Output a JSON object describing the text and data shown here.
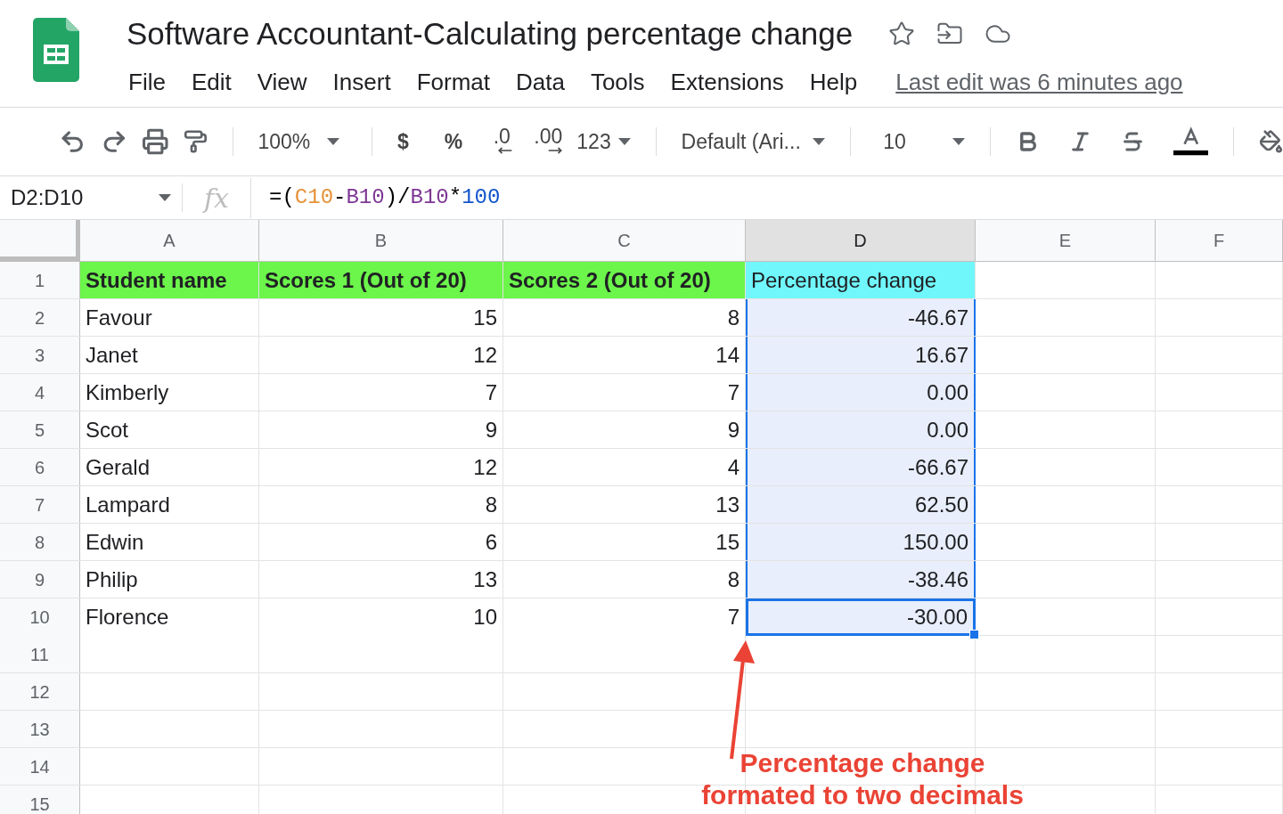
{
  "document": {
    "title": "Software Accountant-Calculating percentage change",
    "last_edit": "Last edit was 6 minutes ago"
  },
  "menu": [
    "File",
    "Edit",
    "View",
    "Insert",
    "Format",
    "Data",
    "Tools",
    "Extensions",
    "Help"
  ],
  "toolbar": {
    "zoom": "100%",
    "currency": "$",
    "percent": "%",
    "decrease_decimals": ".0",
    "increase_decimals": ".00",
    "number_format": "123",
    "font": "Default (Ari...",
    "font_size": "10"
  },
  "formula_bar": {
    "name_box": "D2:D10",
    "function_label": "fx",
    "tokens": [
      {
        "text": "=(",
        "color": "#000000"
      },
      {
        "text": "C10",
        "color": "#e69138"
      },
      {
        "text": "-",
        "color": "#000000"
      },
      {
        "text": "B10",
        "color": "#7e3794"
      },
      {
        "text": ")/",
        "color": "#000000"
      },
      {
        "text": "B10",
        "color": "#7e3794"
      },
      {
        "text": "*",
        "color": "#000000"
      },
      {
        "text": "100",
        "color": "#1155cc"
      }
    ]
  },
  "columns": [
    {
      "label": "A",
      "selected": false
    },
    {
      "label": "B",
      "selected": false
    },
    {
      "label": "C",
      "selected": false
    },
    {
      "label": "D",
      "selected": true
    },
    {
      "label": "E",
      "selected": false
    },
    {
      "label": "F",
      "selected": false
    }
  ],
  "rows": [
    {
      "number": "1",
      "cells": [
        {
          "text": "Student name",
          "kind": "header",
          "color": "#6cf54b",
          "selected": false,
          "active": false
        },
        {
          "text": "Scores 1 (Out of 20)",
          "kind": "header",
          "color": "#6cf54b",
          "selected": false,
          "active": false
        },
        {
          "text": "Scores 2 (Out of 20)",
          "kind": "header",
          "color": "#6cf54b",
          "selected": false,
          "active": false
        },
        {
          "text": "Percentage change",
          "kind": "text",
          "color": "#6ff7fb",
          "selected": false,
          "active": false
        }
      ]
    },
    {
      "number": "2",
      "cells": [
        {
          "text": "Favour",
          "kind": "text",
          "selected": false,
          "active": false
        },
        {
          "text": "15",
          "kind": "number",
          "selected": false,
          "active": false
        },
        {
          "text": "8",
          "kind": "number",
          "selected": false,
          "active": false
        },
        {
          "text": "-46.67",
          "kind": "number",
          "selected": true,
          "active": false
        }
      ]
    },
    {
      "number": "3",
      "cells": [
        {
          "text": "Janet",
          "kind": "text",
          "selected": false,
          "active": false
        },
        {
          "text": "12",
          "kind": "number",
          "selected": false,
          "active": false
        },
        {
          "text": "14",
          "kind": "number",
          "selected": false,
          "active": false
        },
        {
          "text": "16.67",
          "kind": "number",
          "selected": true,
          "active": false
        }
      ]
    },
    {
      "number": "4",
      "cells": [
        {
          "text": "Kimberly",
          "kind": "text",
          "selected": false,
          "active": false
        },
        {
          "text": "7",
          "kind": "number",
          "selected": false,
          "active": false
        },
        {
          "text": "7",
          "kind": "number",
          "selected": false,
          "active": false
        },
        {
          "text": "0.00",
          "kind": "number",
          "selected": true,
          "active": false
        }
      ]
    },
    {
      "number": "5",
      "cells": [
        {
          "text": "Scot",
          "kind": "text",
          "selected": false,
          "active": false
        },
        {
          "text": "9",
          "kind": "number",
          "selected": false,
          "active": false
        },
        {
          "text": "9",
          "kind": "number",
          "selected": false,
          "active": false
        },
        {
          "text": "0.00",
          "kind": "number",
          "selected": true,
          "active": false
        }
      ]
    },
    {
      "number": "6",
      "cells": [
        {
          "text": "Gerald",
          "kind": "text",
          "selected": false,
          "active": false
        },
        {
          "text": "12",
          "kind": "number",
          "selected": false,
          "active": false
        },
        {
          "text": "4",
          "kind": "number",
          "selected": false,
          "active": false
        },
        {
          "text": "-66.67",
          "kind": "number",
          "selected": true,
          "active": false
        }
      ]
    },
    {
      "number": "7",
      "cells": [
        {
          "text": "Lampard",
          "kind": "text",
          "selected": false,
          "active": false
        },
        {
          "text": "8",
          "kind": "number",
          "selected": false,
          "active": false
        },
        {
          "text": "13",
          "kind": "number",
          "selected": false,
          "active": false
        },
        {
          "text": "62.50",
          "kind": "number",
          "selected": true,
          "active": false
        }
      ]
    },
    {
      "number": "8",
      "cells": [
        {
          "text": "Edwin",
          "kind": "text",
          "selected": false,
          "active": false
        },
        {
          "text": "6",
          "kind": "number",
          "selected": false,
          "active": false
        },
        {
          "text": "15",
          "kind": "number",
          "selected": false,
          "active": false
        },
        {
          "text": "150.00",
          "kind": "number",
          "selected": true,
          "active": false
        }
      ]
    },
    {
      "number": "9",
      "cells": [
        {
          "text": "Philip",
          "kind": "text",
          "selected": false,
          "active": false
        },
        {
          "text": "13",
          "kind": "number",
          "selected": false,
          "active": false
        },
        {
          "text": "8",
          "kind": "number",
          "selected": false,
          "active": false
        },
        {
          "text": "-38.46",
          "kind": "number",
          "selected": true,
          "active": false
        }
      ]
    },
    {
      "number": "10",
      "cells": [
        {
          "text": "Florence",
          "kind": "text",
          "selected": false,
          "active": false
        },
        {
          "text": "10",
          "kind": "number",
          "selected": false,
          "active": false
        },
        {
          "text": "7",
          "kind": "number",
          "selected": false,
          "active": false
        },
        {
          "text": "-30.00",
          "kind": "number",
          "selected": true,
          "active": true
        }
      ]
    },
    {
      "number": "11",
      "cells": []
    },
    {
      "number": "12",
      "cells": []
    },
    {
      "number": "13",
      "cells": []
    },
    {
      "number": "14",
      "cells": []
    },
    {
      "number": "15",
      "cells": []
    }
  ],
  "annotation": {
    "text": "Percentage change formated to two decimals"
  }
}
